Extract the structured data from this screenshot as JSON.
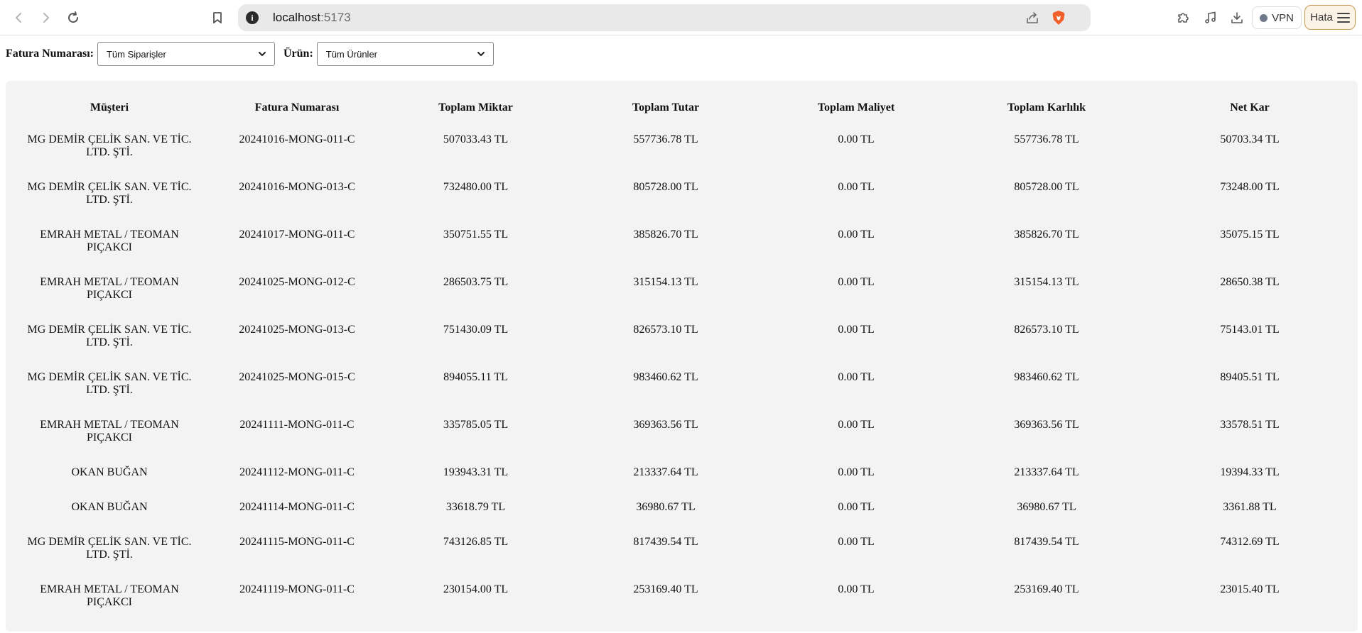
{
  "browser": {
    "url_host": "localhost",
    "url_port": ":5173",
    "vpn_label": "VPN",
    "menu_label": "Hata"
  },
  "filters": {
    "invoice_label": "Fatura Numarası:",
    "invoice_selected": "Tüm Siparişler",
    "product_label": "Ürün:",
    "product_selected": "Tüm Ürünler"
  },
  "table": {
    "headers": [
      "Müşteri",
      "Fatura Numarası",
      "Toplam Miktar",
      "Toplam Tutar",
      "Toplam Maliyet",
      "Toplam Karlılık",
      "Net Kar"
    ],
    "rows": [
      {
        "customer": "MG DEMİR ÇELİK SAN. VE TİC. LTD. ŞTİ.",
        "invoice": "20241016-MONG-011-C",
        "qty": "507033.43 TL",
        "total": "557736.78 TL",
        "cost": "0.00 TL",
        "profit": "557736.78 TL",
        "net": "50703.34 TL"
      },
      {
        "customer": "MG DEMİR ÇELİK SAN. VE TİC. LTD. ŞTİ.",
        "invoice": "20241016-MONG-013-C",
        "qty": "732480.00 TL",
        "total": "805728.00 TL",
        "cost": "0.00 TL",
        "profit": "805728.00 TL",
        "net": "73248.00 TL"
      },
      {
        "customer": "EMRAH METAL / TEOMAN PIÇAKCI",
        "invoice": "20241017-MONG-011-C",
        "qty": "350751.55 TL",
        "total": "385826.70 TL",
        "cost": "0.00 TL",
        "profit": "385826.70 TL",
        "net": "35075.15 TL"
      },
      {
        "customer": "EMRAH METAL / TEOMAN PIÇAKCI",
        "invoice": "20241025-MONG-012-C",
        "qty": "286503.75 TL",
        "total": "315154.13 TL",
        "cost": "0.00 TL",
        "profit": "315154.13 TL",
        "net": "28650.38 TL"
      },
      {
        "customer": "MG DEMİR ÇELİK SAN. VE TİC. LTD. ŞTİ.",
        "invoice": "20241025-MONG-013-C",
        "qty": "751430.09 TL",
        "total": "826573.10 TL",
        "cost": "0.00 TL",
        "profit": "826573.10 TL",
        "net": "75143.01 TL"
      },
      {
        "customer": "MG DEMİR ÇELİK SAN. VE TİC. LTD. ŞTİ.",
        "invoice": "20241025-MONG-015-C",
        "qty": "894055.11 TL",
        "total": "983460.62 TL",
        "cost": "0.00 TL",
        "profit": "983460.62 TL",
        "net": "89405.51 TL"
      },
      {
        "customer": "EMRAH METAL / TEOMAN PIÇAKCI",
        "invoice": "20241111-MONG-011-C",
        "qty": "335785.05 TL",
        "total": "369363.56 TL",
        "cost": "0.00 TL",
        "profit": "369363.56 TL",
        "net": "33578.51 TL"
      },
      {
        "customer": "OKAN BUĞAN",
        "invoice": "20241112-MONG-011-C",
        "qty": "193943.31 TL",
        "total": "213337.64 TL",
        "cost": "0.00 TL",
        "profit": "213337.64 TL",
        "net": "19394.33 TL"
      },
      {
        "customer": "OKAN BUĞAN",
        "invoice": "20241114-MONG-011-C",
        "qty": "33618.79 TL",
        "total": "36980.67 TL",
        "cost": "0.00 TL",
        "profit": "36980.67 TL",
        "net": "3361.88 TL"
      },
      {
        "customer": "MG DEMİR ÇELİK SAN. VE TİC. LTD. ŞTİ.",
        "invoice": "20241115-MONG-011-C",
        "qty": "743126.85 TL",
        "total": "817439.54 TL",
        "cost": "0.00 TL",
        "profit": "817439.54 TL",
        "net": "74312.69 TL"
      },
      {
        "customer": "EMRAH METAL / TEOMAN PIÇAKCI",
        "invoice": "20241119-MONG-011-C",
        "qty": "230154.00 TL",
        "total": "253169.40 TL",
        "cost": "0.00 TL",
        "profit": "253169.40 TL",
        "net": "23015.40 TL"
      }
    ]
  }
}
